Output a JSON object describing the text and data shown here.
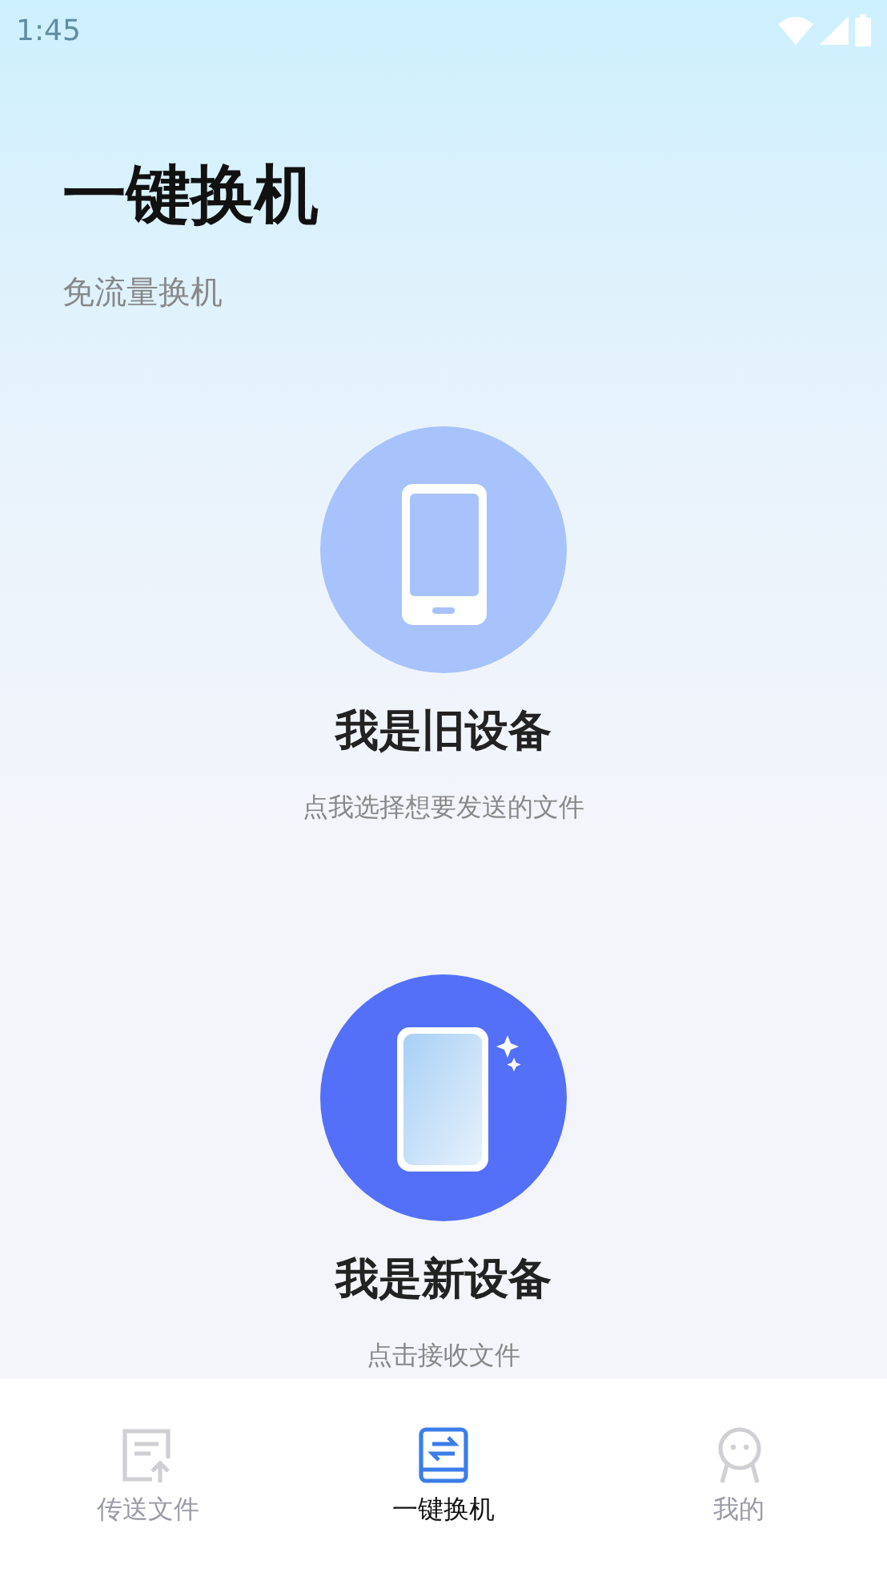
{
  "status_bar": {
    "time": "1:45"
  },
  "header": {
    "title": "一键换机",
    "subtitle": "免流量换机"
  },
  "devices": [
    {
      "kind": "old",
      "title": "我是旧设备",
      "hint": "点我选择想要发送的文件"
    },
    {
      "kind": "new",
      "title": "我是新设备",
      "hint": "点击接收文件"
    }
  ],
  "tabs": [
    {
      "kind": "send",
      "label": "传送文件",
      "selected": false
    },
    {
      "kind": "switch",
      "label": "一键换机",
      "selected": true
    },
    {
      "kind": "me",
      "label": "我的",
      "selected": false
    }
  ]
}
